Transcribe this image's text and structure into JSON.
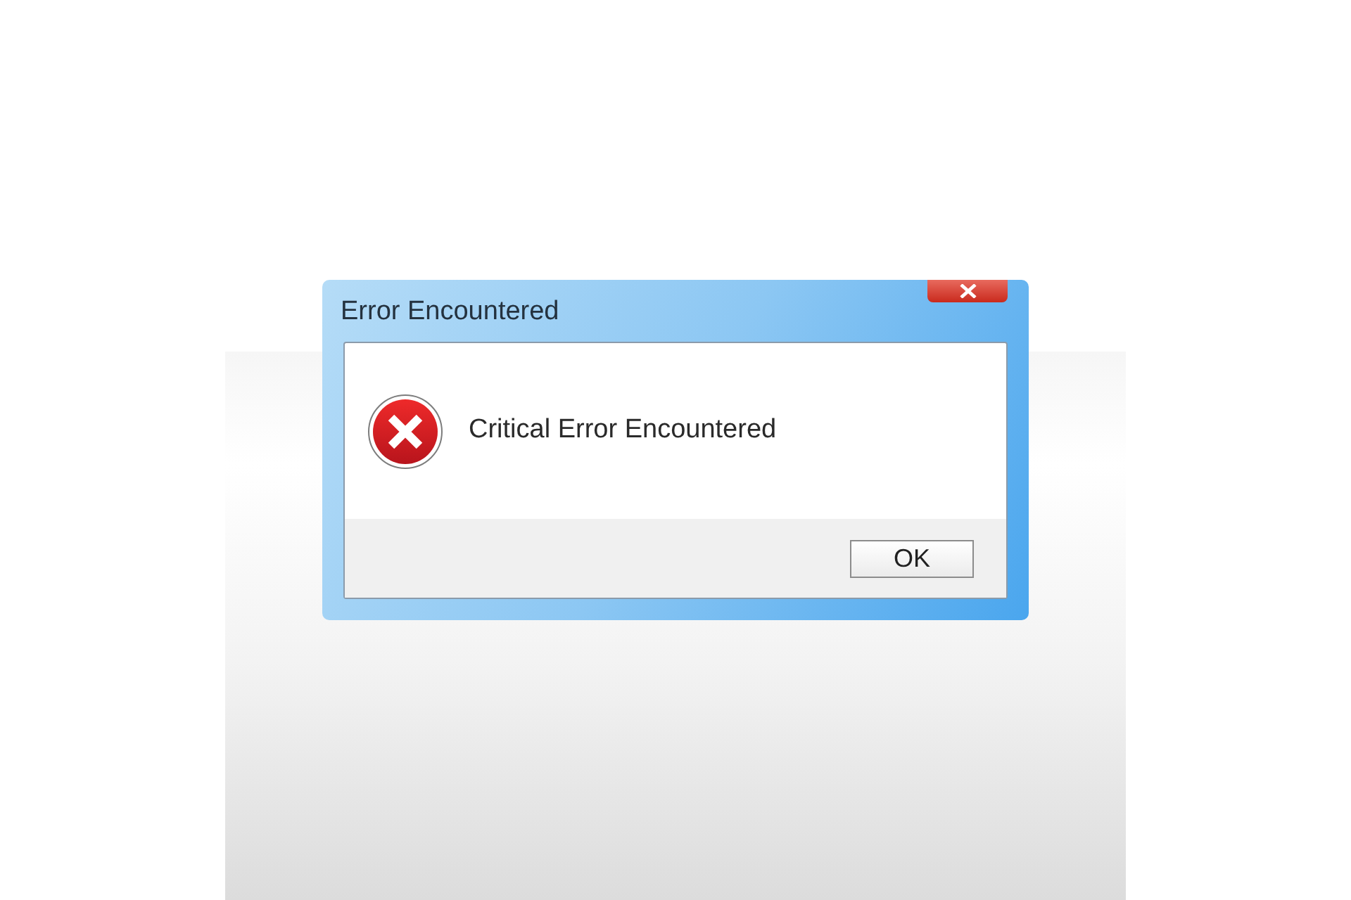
{
  "window": {
    "title": "Error Encountered"
  },
  "message": "Critical Error Encountered",
  "buttons": [
    "OK"
  ]
}
